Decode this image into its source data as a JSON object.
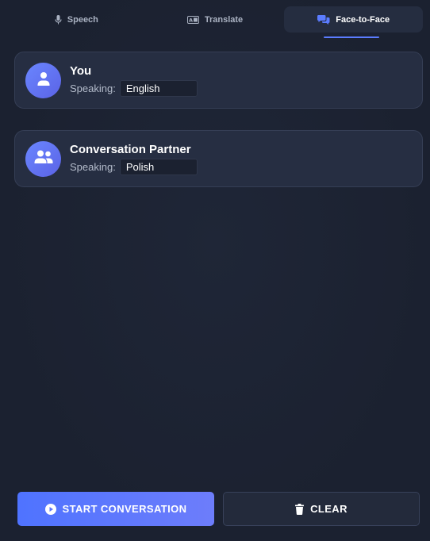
{
  "tabs": [
    {
      "label": "Speech",
      "icon": "microphone-icon",
      "active": false
    },
    {
      "label": "Translate",
      "icon": "translate-icon",
      "active": false
    },
    {
      "label": "Face-to-Face",
      "icon": "chat-bubbles-icon",
      "active": true
    }
  ],
  "participants": {
    "you": {
      "title": "You",
      "speaking_label": "Speaking:",
      "language": "English",
      "icon": "user-icon"
    },
    "partner": {
      "title": "Conversation Partner",
      "speaking_label": "Speaking:",
      "language": "Polish",
      "icon": "users-icon"
    }
  },
  "actions": {
    "start_label": "START CONVERSATION",
    "start_icon": "play-circle-icon",
    "clear_label": "CLEAR",
    "clear_icon": "trash-icon"
  },
  "colors": {
    "background": "#1b2130",
    "card": "#262e42",
    "accent": "#5b7cff",
    "active_tab": "#252d40"
  }
}
